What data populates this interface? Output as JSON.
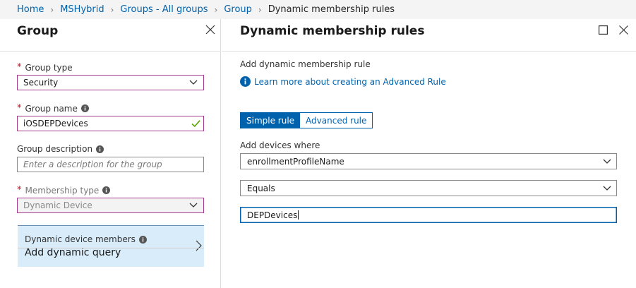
{
  "breadcrumb": {
    "items": [
      "Home",
      "MSHybrid",
      "Groups - All groups",
      "Group"
    ],
    "current": "Dynamic membership rules"
  },
  "left_blade": {
    "title": "Group",
    "group_type": {
      "label": "Group type",
      "value": "Security"
    },
    "group_name": {
      "label": "Group name",
      "value": "iOSDEPDevices"
    },
    "group_description": {
      "label": "Group description",
      "placeholder": "Enter a description for the group"
    },
    "membership_type": {
      "label": "Membership type",
      "value": "Dynamic Device"
    },
    "dynamic_members": {
      "label": "Dynamic device members",
      "value": "Add dynamic query"
    }
  },
  "right_blade": {
    "title": "Dynamic membership rules",
    "subtitle": "Add dynamic membership rule",
    "learn_more": "Learn more about creating an Advanced Rule",
    "tabs": {
      "simple": "Simple rule",
      "advanced": "Advanced rule"
    },
    "add_devices_label": "Add devices where",
    "property": "enrollmentProfileName",
    "operator": "Equals",
    "value": "DEPDevices"
  },
  "colors": {
    "accent": "#0062ad",
    "required": "#c50f1f",
    "focus_border": "#a4378f",
    "valid": "#57a300",
    "tile_bg": "#d9ecfa"
  },
  "icons": [
    "chevron-right-icon",
    "close-icon",
    "info-icon",
    "chevron-down-icon",
    "checkmark-icon",
    "maximize-icon",
    "info-circle-icon"
  ]
}
